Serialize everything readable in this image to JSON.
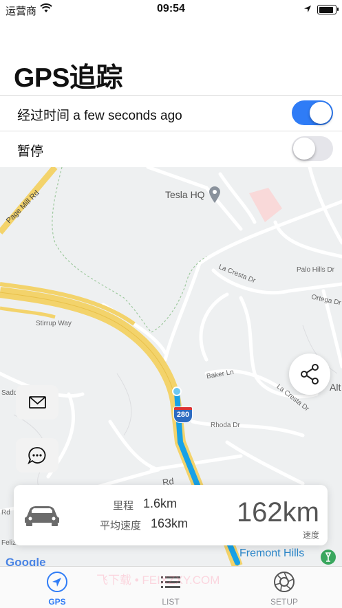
{
  "status_bar": {
    "carrier": "运营商",
    "time": "09:54"
  },
  "header": {
    "title": "GPS追踪"
  },
  "settings": {
    "elapsed_label": "经过时间 a few seconds ago",
    "elapsed_toggle_on": true,
    "pause_label": "暂停",
    "pause_toggle_on": false
  },
  "map": {
    "poi": "Tesla HQ",
    "roads": [
      "Page Mill Rd",
      "Palo Hills Dr",
      "La Cresta Dr",
      "Ortega Dr",
      "Stirrup Way",
      "Baker Ln",
      "La Cresta Dr",
      "Rhoda Dr",
      "Rd",
      "Rd",
      "Sadd",
      "Feliz",
      "Alt"
    ],
    "highway_shield": "280",
    "place": "Fremont Hills",
    "attribution": "Google"
  },
  "info_card": {
    "distance_label": "里程",
    "distance_value": "1.6km",
    "avg_speed_label": "平均速度",
    "avg_speed_value": "163km",
    "speed_value": "162km",
    "speed_unit": "速度"
  },
  "tabbar": {
    "tabs": [
      {
        "label": "GPS"
      },
      {
        "label": "LIST"
      },
      {
        "label": "SETUP"
      }
    ],
    "active": "GPS"
  },
  "watermark": "飞下载 • FEIXZXY.COM",
  "colors": {
    "accent": "#2f7cf6",
    "highway": "#f3d36b",
    "route": "#18a1e6"
  }
}
